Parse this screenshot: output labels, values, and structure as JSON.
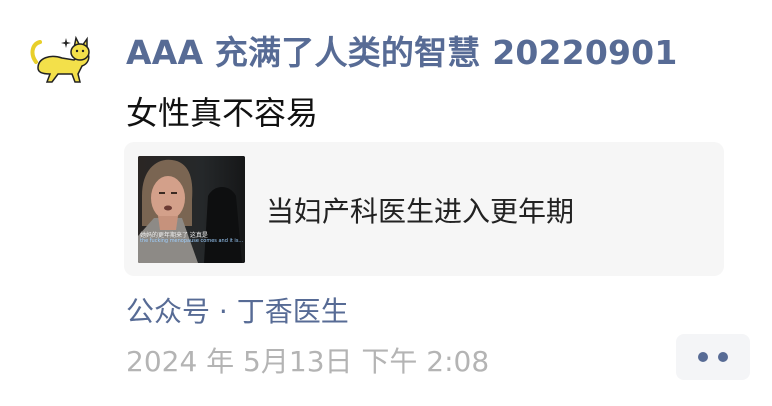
{
  "post": {
    "author": "AAA 充满了人类的智慧 20220901",
    "text": "女性真不容易",
    "link_card": {
      "title": "当妇产科医生进入更年期",
      "thumbnail_caption_cn": "她妈的更年期来了 这真是",
      "thumbnail_caption_en": "the fucking menopause comes and it is..."
    },
    "source": "公众号 · 丁香医生",
    "timestamp": "2024 年 5月13日 下午 2:08",
    "more_icon": "more-dots-icon"
  },
  "colors": {
    "link_blue": "#576b95",
    "text_dark": "#111111",
    "timestamp_gray": "#b4b4b4",
    "card_bg": "#f6f6f6",
    "avatar_yellow": "#f3e04a"
  }
}
